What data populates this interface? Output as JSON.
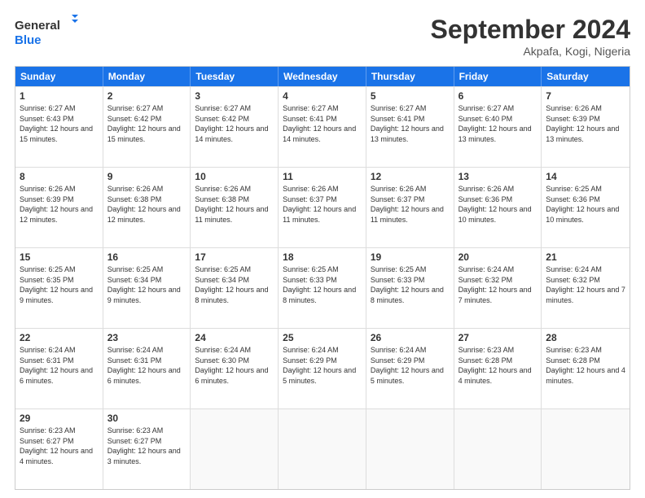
{
  "logo": {
    "line1": "General",
    "line2": "Blue"
  },
  "title": "September 2024",
  "location": "Akpafa, Kogi, Nigeria",
  "days": [
    "Sunday",
    "Monday",
    "Tuesday",
    "Wednesday",
    "Thursday",
    "Friday",
    "Saturday"
  ],
  "weeks": [
    [
      {
        "day": 1,
        "sunrise": "6:27 AM",
        "sunset": "6:43 PM",
        "daylight": "12 hours and 15 minutes."
      },
      {
        "day": 2,
        "sunrise": "6:27 AM",
        "sunset": "6:42 PM",
        "daylight": "12 hours and 15 minutes."
      },
      {
        "day": 3,
        "sunrise": "6:27 AM",
        "sunset": "6:42 PM",
        "daylight": "12 hours and 14 minutes."
      },
      {
        "day": 4,
        "sunrise": "6:27 AM",
        "sunset": "6:41 PM",
        "daylight": "12 hours and 14 minutes."
      },
      {
        "day": 5,
        "sunrise": "6:27 AM",
        "sunset": "6:41 PM",
        "daylight": "12 hours and 13 minutes."
      },
      {
        "day": 6,
        "sunrise": "6:27 AM",
        "sunset": "6:40 PM",
        "daylight": "12 hours and 13 minutes."
      },
      {
        "day": 7,
        "sunrise": "6:26 AM",
        "sunset": "6:39 PM",
        "daylight": "12 hours and 13 minutes."
      }
    ],
    [
      {
        "day": 8,
        "sunrise": "6:26 AM",
        "sunset": "6:39 PM",
        "daylight": "12 hours and 12 minutes."
      },
      {
        "day": 9,
        "sunrise": "6:26 AM",
        "sunset": "6:38 PM",
        "daylight": "12 hours and 12 minutes."
      },
      {
        "day": 10,
        "sunrise": "6:26 AM",
        "sunset": "6:38 PM",
        "daylight": "12 hours and 11 minutes."
      },
      {
        "day": 11,
        "sunrise": "6:26 AM",
        "sunset": "6:37 PM",
        "daylight": "12 hours and 11 minutes."
      },
      {
        "day": 12,
        "sunrise": "6:26 AM",
        "sunset": "6:37 PM",
        "daylight": "12 hours and 11 minutes."
      },
      {
        "day": 13,
        "sunrise": "6:26 AM",
        "sunset": "6:36 PM",
        "daylight": "12 hours and 10 minutes."
      },
      {
        "day": 14,
        "sunrise": "6:25 AM",
        "sunset": "6:36 PM",
        "daylight": "12 hours and 10 minutes."
      }
    ],
    [
      {
        "day": 15,
        "sunrise": "6:25 AM",
        "sunset": "6:35 PM",
        "daylight": "12 hours and 9 minutes."
      },
      {
        "day": 16,
        "sunrise": "6:25 AM",
        "sunset": "6:34 PM",
        "daylight": "12 hours and 9 minutes."
      },
      {
        "day": 17,
        "sunrise": "6:25 AM",
        "sunset": "6:34 PM",
        "daylight": "12 hours and 8 minutes."
      },
      {
        "day": 18,
        "sunrise": "6:25 AM",
        "sunset": "6:33 PM",
        "daylight": "12 hours and 8 minutes."
      },
      {
        "day": 19,
        "sunrise": "6:25 AM",
        "sunset": "6:33 PM",
        "daylight": "12 hours and 8 minutes."
      },
      {
        "day": 20,
        "sunrise": "6:24 AM",
        "sunset": "6:32 PM",
        "daylight": "12 hours and 7 minutes."
      },
      {
        "day": 21,
        "sunrise": "6:24 AM",
        "sunset": "6:32 PM",
        "daylight": "12 hours and 7 minutes."
      }
    ],
    [
      {
        "day": 22,
        "sunrise": "6:24 AM",
        "sunset": "6:31 PM",
        "daylight": "12 hours and 6 minutes."
      },
      {
        "day": 23,
        "sunrise": "6:24 AM",
        "sunset": "6:31 PM",
        "daylight": "12 hours and 6 minutes."
      },
      {
        "day": 24,
        "sunrise": "6:24 AM",
        "sunset": "6:30 PM",
        "daylight": "12 hours and 6 minutes."
      },
      {
        "day": 25,
        "sunrise": "6:24 AM",
        "sunset": "6:29 PM",
        "daylight": "12 hours and 5 minutes."
      },
      {
        "day": 26,
        "sunrise": "6:24 AM",
        "sunset": "6:29 PM",
        "daylight": "12 hours and 5 minutes."
      },
      {
        "day": 27,
        "sunrise": "6:23 AM",
        "sunset": "6:28 PM",
        "daylight": "12 hours and 4 minutes."
      },
      {
        "day": 28,
        "sunrise": "6:23 AM",
        "sunset": "6:28 PM",
        "daylight": "12 hours and 4 minutes."
      }
    ],
    [
      {
        "day": 29,
        "sunrise": "6:23 AM",
        "sunset": "6:27 PM",
        "daylight": "12 hours and 4 minutes."
      },
      {
        "day": 30,
        "sunrise": "6:23 AM",
        "sunset": "6:27 PM",
        "daylight": "12 hours and 3 minutes."
      },
      null,
      null,
      null,
      null,
      null
    ]
  ]
}
